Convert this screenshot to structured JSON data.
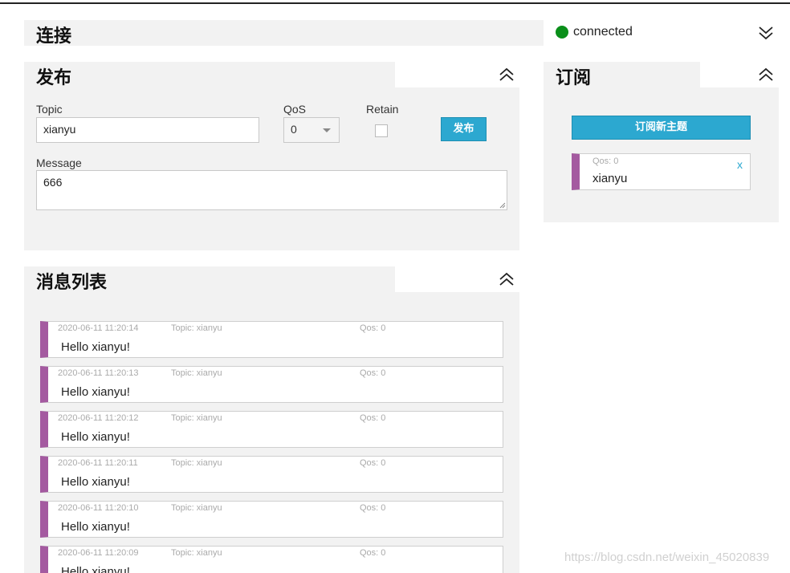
{
  "connection": {
    "title": "连接",
    "status_text": "connected",
    "status_color": "#0a8f1a"
  },
  "publish": {
    "title": "发布",
    "topic_label": "Topic",
    "topic_value": "xianyu",
    "qos_label": "QoS",
    "qos_value": "0",
    "retain_label": "Retain",
    "retain_checked": false,
    "publish_button": "发布",
    "message_label": "Message",
    "message_value": "666"
  },
  "subscribe": {
    "title": "订阅",
    "new_button": "订阅新主题",
    "items": [
      {
        "qos": "Qos: 0",
        "topic": "xianyu",
        "remove": "x"
      }
    ]
  },
  "messages": {
    "title": "消息列表",
    "items": [
      {
        "time": "2020-06-11 11:20:14",
        "topic": "Topic: xianyu",
        "qos": "Qos: 0",
        "body": "Hello xianyu!"
      },
      {
        "time": "2020-06-11 11:20:13",
        "topic": "Topic: xianyu",
        "qos": "Qos: 0",
        "body": "Hello xianyu!"
      },
      {
        "time": "2020-06-11 11:20:12",
        "topic": "Topic: xianyu",
        "qos": "Qos: 0",
        "body": "Hello xianyu!"
      },
      {
        "time": "2020-06-11 11:20:11",
        "topic": "Topic: xianyu",
        "qos": "Qos: 0",
        "body": "Hello xianyu!"
      },
      {
        "time": "2020-06-11 11:20:10",
        "topic": "Topic: xianyu",
        "qos": "Qos: 0",
        "body": "Hello xianyu!"
      },
      {
        "time": "2020-06-11 11:20:09",
        "topic": "Topic: xianyu",
        "qos": "Qos: 0",
        "body": "Hello xianyu!"
      }
    ]
  },
  "colors": {
    "accent": "#2ca8d0",
    "item_bar": "#a45aa0",
    "panel_bg": "#f2f2f2"
  },
  "watermark": "https://blog.csdn.net/weixin_45020839"
}
